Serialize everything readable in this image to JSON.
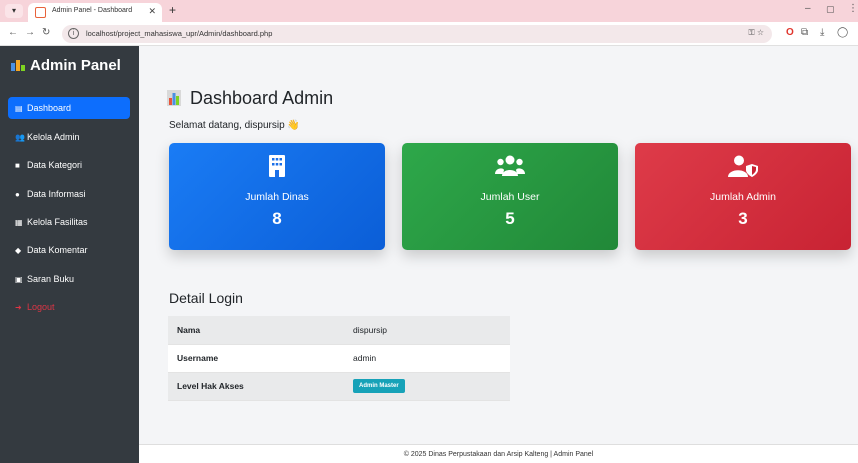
{
  "browser": {
    "tab_title": "Admin Panel - Dashboard",
    "url": "localhost/project_mahasiswa_upr/Admin/dashboard.php"
  },
  "sidebar": {
    "brand": "Admin Panel",
    "items": [
      {
        "label": "Dashboard",
        "icon": "chart-icon"
      },
      {
        "label": "Kelola Admin",
        "icon": "users-cog-icon"
      },
      {
        "label": "Data Kategori",
        "icon": "folder-icon"
      },
      {
        "label": "Data Informasi",
        "icon": "info-circle-icon"
      },
      {
        "label": "Kelola Fasilitas",
        "icon": "building-icon"
      },
      {
        "label": "Data Komentar",
        "icon": "comments-icon"
      },
      {
        "label": "Saran Buku",
        "icon": "book-icon"
      },
      {
        "label": "Logout",
        "icon": "sign-out-icon"
      }
    ]
  },
  "main": {
    "title": "Dashboard Admin",
    "welcome": "Selamat datang, dispursip 👋",
    "cards": [
      {
        "label": "Jumlah Dinas",
        "value": "8",
        "color": "#0d6efd",
        "icon": "building-icon"
      },
      {
        "label": "Jumlah User",
        "value": "5",
        "color": "#28a745",
        "icon": "users-icon"
      },
      {
        "label": "Jumlah Admin",
        "value": "3",
        "color": "#dc3545",
        "icon": "user-shield-icon"
      }
    ],
    "detail": {
      "title": "Detail Login",
      "rows": [
        {
          "key": "Nama",
          "value": "dispursip"
        },
        {
          "key": "Username",
          "value": "admin"
        },
        {
          "key": "Level Hak Akses",
          "value": "Admin Master"
        }
      ]
    },
    "footer": "© 2025 Dinas Perpustakaan dan Arsip Kalteng | Admin Panel"
  }
}
